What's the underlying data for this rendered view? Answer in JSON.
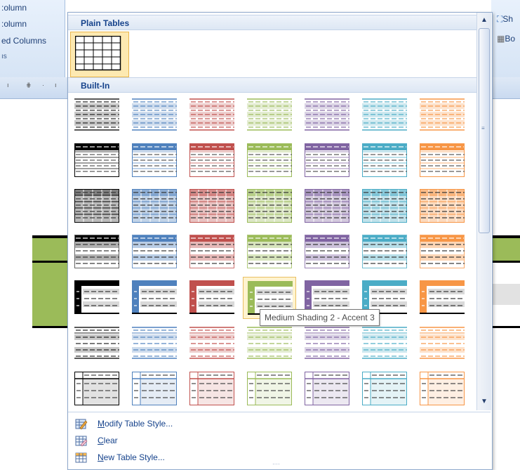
{
  "ribbon": {
    "left_items": [
      ":olumn",
      ":olumn",
      "ed Columns",
      "ıs"
    ],
    "right_items": [
      "Sh",
      "Bo"
    ]
  },
  "gallery": {
    "sections": [
      {
        "title": "Plain Tables"
      },
      {
        "title": "Built-In"
      }
    ],
    "selected_style": "Table Grid",
    "accent_colors": [
      "#000000",
      "#4f81bd",
      "#c0504d",
      "#9bbb59",
      "#8064a2",
      "#4bacc6",
      "#f79646"
    ],
    "row_styles": [
      "Light Shading",
      "Light List",
      "Light Grid",
      "Medium Shading 1",
      "Medium Shading 2",
      "Medium List 1",
      "Medium List 2"
    ],
    "hovered": {
      "row": 4,
      "col": 3
    }
  },
  "tooltip": {
    "text": "Medium Shading 2 - Accent 3"
  },
  "menu": {
    "items": [
      {
        "label": "Modify Table Style...",
        "icon": "modify-table-style-icon"
      },
      {
        "label": "Clear",
        "icon": "clear-table-style-icon"
      },
      {
        "label": "New Table Style...",
        "icon": "new-table-style-icon"
      }
    ]
  }
}
